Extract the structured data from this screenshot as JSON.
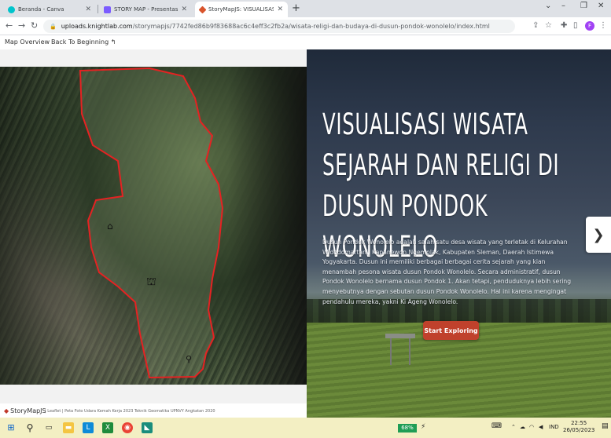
{
  "browser": {
    "tabs": [
      {
        "label": "Beranda - Canva",
        "active": false,
        "favicon_color": "#00c4cc"
      },
      {
        "label": "STORY MAP - Presentasi",
        "active": false,
        "favicon_color": "#7b5cff"
      },
      {
        "label": "StoryMapJS: VISUALISASI WISAT",
        "active": true,
        "favicon_color": "#d9542c"
      }
    ],
    "url_host": "uploads.knightlab.com",
    "url_path": "/storymapjs/7742fed86b9f83688ac6c4eff3c2fb2a/wisata-religi-dan-budaya-di-dusun-pondok-wonolelo/index.html",
    "profile_initial": "F",
    "profile_color": "#a142f4"
  },
  "storymap": {
    "header": {
      "map_overview": "Map Overview",
      "back_to_beginning": "Back To Beginning"
    },
    "slide": {
      "headline": "VISUALISASI WISATA SEJARAH DAN RELIGI DI DUSUN PONDOK WONOLELO",
      "text": "Dusun Pondok Wonolelo adalah salah satu desa wisata yang terletak di Kelurahan Widodomartani, Kapanewon Ngemplak, Kabupaten Sleman, Daerah Istimewa Yogyakarta. Dusun ini memiliki berbagai berbagai cerita sejarah yang kian menambah pesona wisata dusun Pondok Wonolelo. Secara administratif, dusun Pondok Wonolelo bernama dusun Pondok 1. Akan tetapi, penduduknya lebih sering menyebutnya dengan sebutan dusun Pondok Wonolelo. Hal ini karena mengingat pendahulu mereka, yakni Ki Ageng Wonolelo.",
      "start_button": "Start Exploring",
      "accent_color": "#c0412c"
    },
    "footer": {
      "brand": "StoryMapJS",
      "credit": "| Leaflet | Peta Foto Udara Kemah Kerja 2023 Teknik Geomatika UPNVY Angkatan 2020"
    }
  },
  "taskbar": {
    "battery": "68%",
    "language": "IND",
    "time": "22:55",
    "date": "26/05/2023"
  }
}
